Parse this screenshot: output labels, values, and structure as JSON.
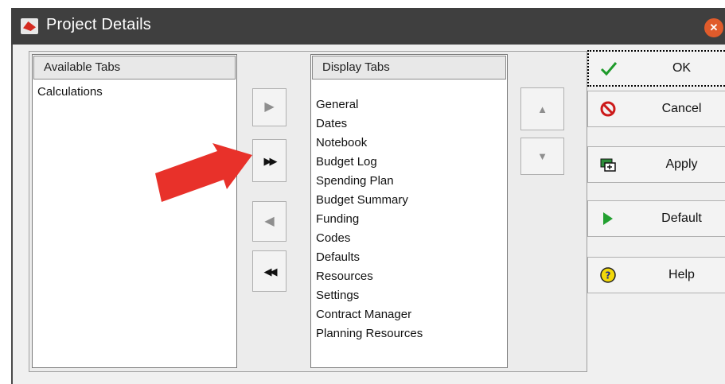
{
  "window": {
    "title": "Project Details"
  },
  "available": {
    "header": "Available Tabs",
    "items": [
      "Calculations"
    ]
  },
  "display": {
    "header": "Display Tabs",
    "items": [
      "General",
      "Dates",
      "Notebook",
      "Budget Log",
      "Spending Plan",
      "Budget Summary",
      "Funding",
      "Codes",
      "Defaults",
      "Resources",
      "Settings",
      "Contract Manager",
      "Planning Resources"
    ]
  },
  "transfer": {
    "move_right": "▶",
    "move_all_right": "▶▶",
    "move_left": "◀",
    "move_all_left": "◀◀"
  },
  "order": {
    "up": "▲",
    "down": "▼"
  },
  "buttons": {
    "ok": "OK",
    "cancel": "Cancel",
    "apply": "Apply",
    "default": "Default",
    "help": "Help"
  },
  "colors": {
    "titlebar": "#3f3f3f",
    "annotation_arrow": "#e8312a",
    "close": "#e05b2b"
  }
}
